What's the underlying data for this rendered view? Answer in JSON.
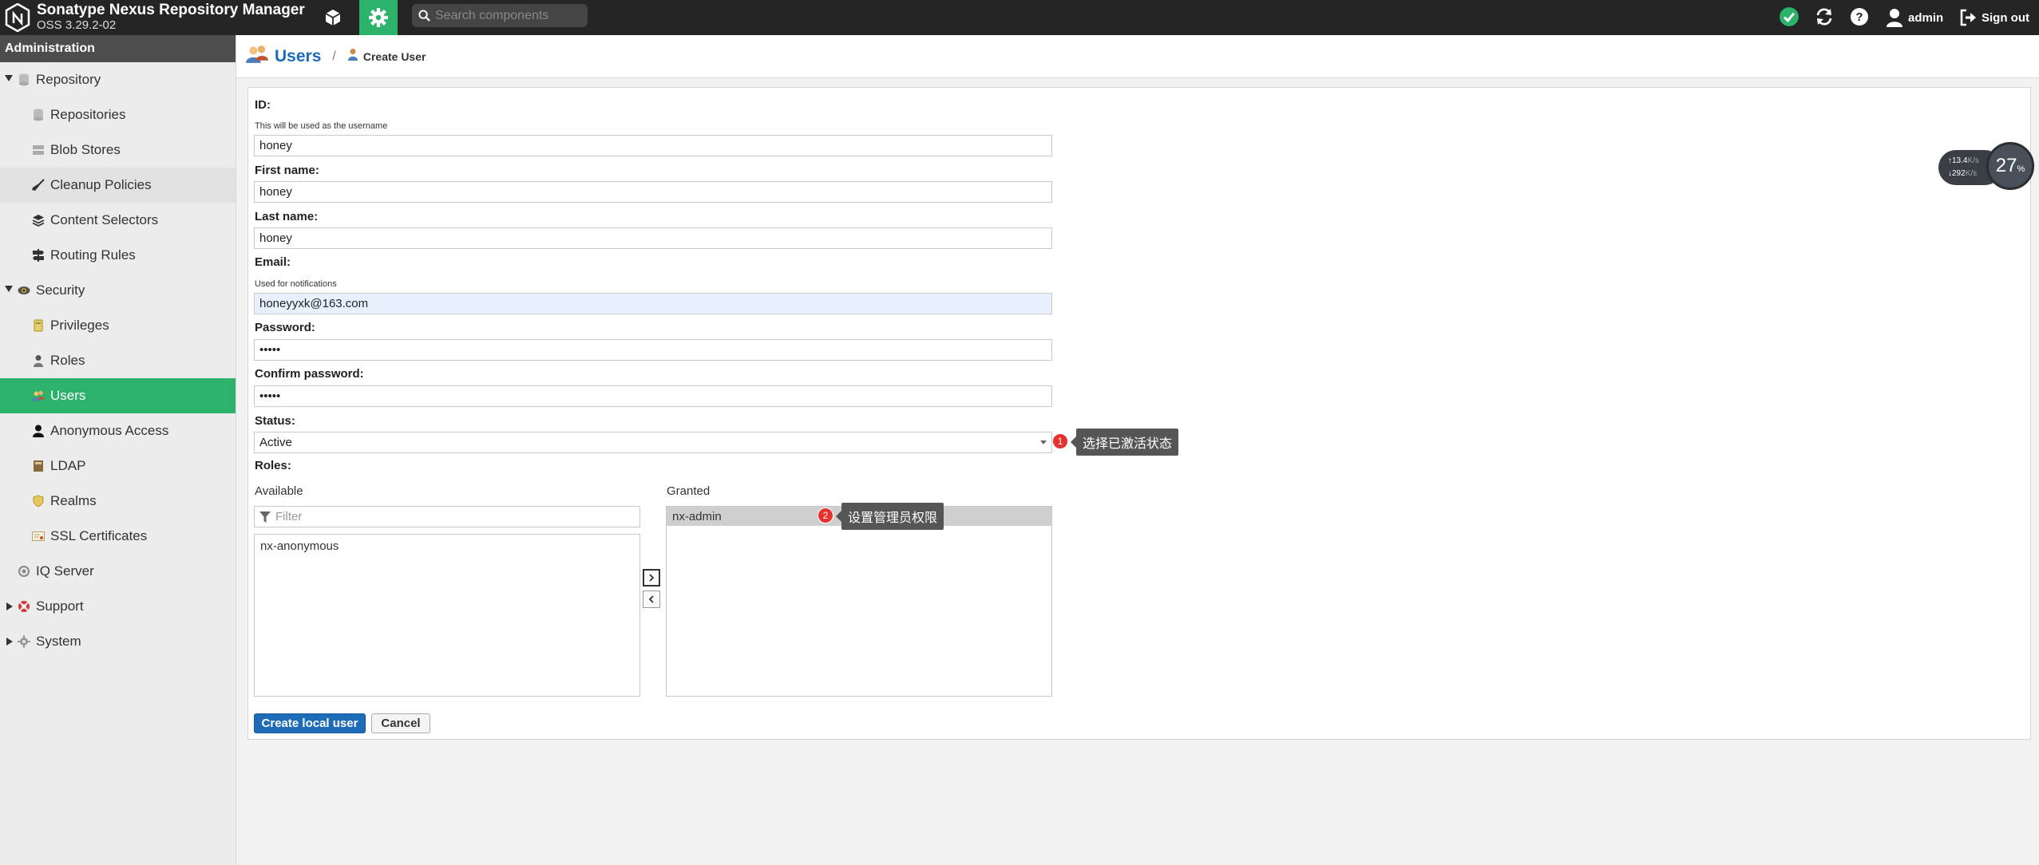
{
  "header": {
    "title": "Sonatype Nexus Repository Manager",
    "version": "OSS 3.29.2-02",
    "search_placeholder": "Search components",
    "user": "admin",
    "signout": "Sign out"
  },
  "sidebar": {
    "heading": "Administration",
    "items": [
      {
        "label": "Repository"
      },
      {
        "label": "Repositories"
      },
      {
        "label": "Blob Stores"
      },
      {
        "label": "Cleanup Policies"
      },
      {
        "label": "Content Selectors"
      },
      {
        "label": "Routing Rules"
      },
      {
        "label": "Security"
      },
      {
        "label": "Privileges"
      },
      {
        "label": "Roles"
      },
      {
        "label": "Users"
      },
      {
        "label": "Anonymous Access"
      },
      {
        "label": "LDAP"
      },
      {
        "label": "Realms"
      },
      {
        "label": "SSL Certificates"
      },
      {
        "label": "IQ Server"
      },
      {
        "label": "Support"
      },
      {
        "label": "System"
      }
    ]
  },
  "breadcrumb": {
    "title": "Users",
    "separator": "/",
    "current": "Create User"
  },
  "form": {
    "id_label": "ID:",
    "id_help": "This will be used as the username",
    "id_value": "honey",
    "first_name_label": "First name:",
    "first_name_value": "honey",
    "last_name_label": "Last name:",
    "last_name_value": "honey",
    "email_label": "Email:",
    "email_help": "Used for notifications",
    "email_value": "honeyyxk@163.com",
    "password_label": "Password:",
    "password_value": "•••••",
    "confirm_label": "Confirm password:",
    "confirm_value": "•••••",
    "status_label": "Status:",
    "status_value": "Active",
    "roles_label": "Roles:",
    "available_label": "Available",
    "filter_placeholder": "Filter",
    "available_items": [
      "nx-anonymous"
    ],
    "granted_label": "Granted",
    "granted_items": [
      "nx-admin"
    ],
    "create_button": "Create local user",
    "cancel_button": "Cancel"
  },
  "annotations": [
    {
      "number": "1",
      "text": "选择已激活状态"
    },
    {
      "number": "2",
      "text": "设置管理员权限"
    }
  ],
  "speed_widget": {
    "up": "13.4",
    "up_unit": "K/s",
    "down": "292",
    "down_unit": "K/s",
    "percent": "27",
    "percent_sign": "%"
  },
  "colors": {
    "accent_green": "#2db26b",
    "link_blue": "#1e6bb8",
    "header_bg": "#252525"
  }
}
